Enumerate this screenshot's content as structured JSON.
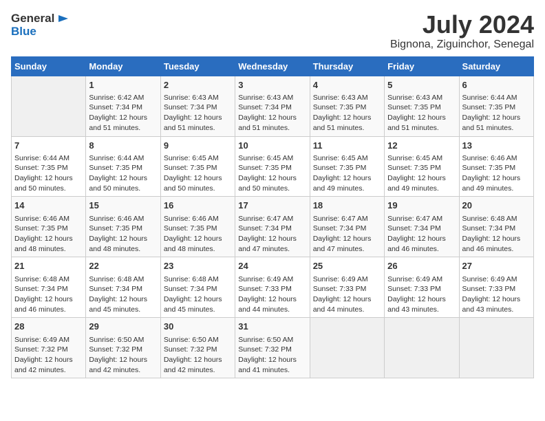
{
  "logo": {
    "general": "General",
    "blue": "Blue"
  },
  "header": {
    "month_year": "July 2024",
    "location": "Bignona, Ziguinchor, Senegal"
  },
  "days_of_week": [
    "Sunday",
    "Monday",
    "Tuesday",
    "Wednesday",
    "Thursday",
    "Friday",
    "Saturday"
  ],
  "weeks": [
    [
      {
        "day": "",
        "sunrise": "",
        "sunset": "",
        "daylight": ""
      },
      {
        "day": "1",
        "sunrise": "6:42 AM",
        "sunset": "7:34 PM",
        "daylight": "12 hours and 51 minutes."
      },
      {
        "day": "2",
        "sunrise": "6:43 AM",
        "sunset": "7:34 PM",
        "daylight": "12 hours and 51 minutes."
      },
      {
        "day": "3",
        "sunrise": "6:43 AM",
        "sunset": "7:34 PM",
        "daylight": "12 hours and 51 minutes."
      },
      {
        "day": "4",
        "sunrise": "6:43 AM",
        "sunset": "7:35 PM",
        "daylight": "12 hours and 51 minutes."
      },
      {
        "day": "5",
        "sunrise": "6:43 AM",
        "sunset": "7:35 PM",
        "daylight": "12 hours and 51 minutes."
      },
      {
        "day": "6",
        "sunrise": "6:44 AM",
        "sunset": "7:35 PM",
        "daylight": "12 hours and 51 minutes."
      }
    ],
    [
      {
        "day": "7",
        "sunrise": "6:44 AM",
        "sunset": "7:35 PM",
        "daylight": "12 hours and 50 minutes."
      },
      {
        "day": "8",
        "sunrise": "6:44 AM",
        "sunset": "7:35 PM",
        "daylight": "12 hours and 50 minutes."
      },
      {
        "day": "9",
        "sunrise": "6:45 AM",
        "sunset": "7:35 PM",
        "daylight": "12 hours and 50 minutes."
      },
      {
        "day": "10",
        "sunrise": "6:45 AM",
        "sunset": "7:35 PM",
        "daylight": "12 hours and 50 minutes."
      },
      {
        "day": "11",
        "sunrise": "6:45 AM",
        "sunset": "7:35 PM",
        "daylight": "12 hours and 49 minutes."
      },
      {
        "day": "12",
        "sunrise": "6:45 AM",
        "sunset": "7:35 PM",
        "daylight": "12 hours and 49 minutes."
      },
      {
        "day": "13",
        "sunrise": "6:46 AM",
        "sunset": "7:35 PM",
        "daylight": "12 hours and 49 minutes."
      }
    ],
    [
      {
        "day": "14",
        "sunrise": "6:46 AM",
        "sunset": "7:35 PM",
        "daylight": "12 hours and 48 minutes."
      },
      {
        "day": "15",
        "sunrise": "6:46 AM",
        "sunset": "7:35 PM",
        "daylight": "12 hours and 48 minutes."
      },
      {
        "day": "16",
        "sunrise": "6:46 AM",
        "sunset": "7:35 PM",
        "daylight": "12 hours and 48 minutes."
      },
      {
        "day": "17",
        "sunrise": "6:47 AM",
        "sunset": "7:34 PM",
        "daylight": "12 hours and 47 minutes."
      },
      {
        "day": "18",
        "sunrise": "6:47 AM",
        "sunset": "7:34 PM",
        "daylight": "12 hours and 47 minutes."
      },
      {
        "day": "19",
        "sunrise": "6:47 AM",
        "sunset": "7:34 PM",
        "daylight": "12 hours and 46 minutes."
      },
      {
        "day": "20",
        "sunrise": "6:48 AM",
        "sunset": "7:34 PM",
        "daylight": "12 hours and 46 minutes."
      }
    ],
    [
      {
        "day": "21",
        "sunrise": "6:48 AM",
        "sunset": "7:34 PM",
        "daylight": "12 hours and 46 minutes."
      },
      {
        "day": "22",
        "sunrise": "6:48 AM",
        "sunset": "7:34 PM",
        "daylight": "12 hours and 45 minutes."
      },
      {
        "day": "23",
        "sunrise": "6:48 AM",
        "sunset": "7:34 PM",
        "daylight": "12 hours and 45 minutes."
      },
      {
        "day": "24",
        "sunrise": "6:49 AM",
        "sunset": "7:33 PM",
        "daylight": "12 hours and 44 minutes."
      },
      {
        "day": "25",
        "sunrise": "6:49 AM",
        "sunset": "7:33 PM",
        "daylight": "12 hours and 44 minutes."
      },
      {
        "day": "26",
        "sunrise": "6:49 AM",
        "sunset": "7:33 PM",
        "daylight": "12 hours and 43 minutes."
      },
      {
        "day": "27",
        "sunrise": "6:49 AM",
        "sunset": "7:33 PM",
        "daylight": "12 hours and 43 minutes."
      }
    ],
    [
      {
        "day": "28",
        "sunrise": "6:49 AM",
        "sunset": "7:32 PM",
        "daylight": "12 hours and 42 minutes."
      },
      {
        "day": "29",
        "sunrise": "6:50 AM",
        "sunset": "7:32 PM",
        "daylight": "12 hours and 42 minutes."
      },
      {
        "day": "30",
        "sunrise": "6:50 AM",
        "sunset": "7:32 PM",
        "daylight": "12 hours and 42 minutes."
      },
      {
        "day": "31",
        "sunrise": "6:50 AM",
        "sunset": "7:32 PM",
        "daylight": "12 hours and 41 minutes."
      },
      {
        "day": "",
        "sunrise": "",
        "sunset": "",
        "daylight": ""
      },
      {
        "day": "",
        "sunrise": "",
        "sunset": "",
        "daylight": ""
      },
      {
        "day": "",
        "sunrise": "",
        "sunset": "",
        "daylight": ""
      }
    ]
  ]
}
